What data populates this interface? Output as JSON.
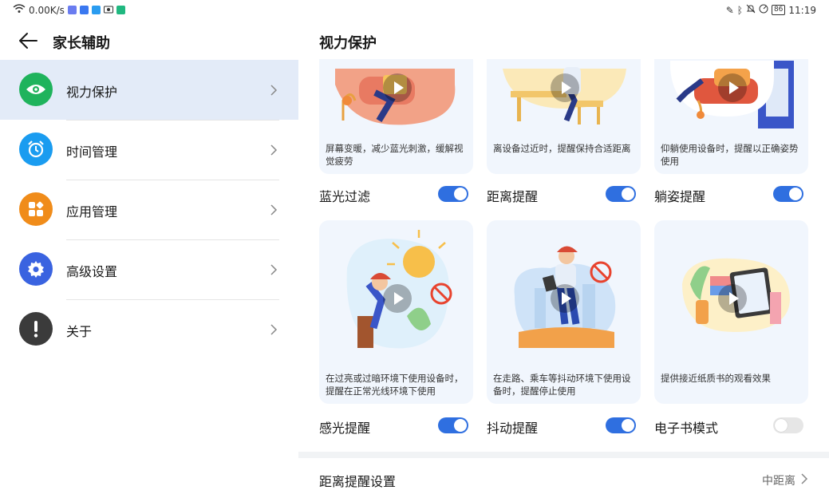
{
  "status_bar": {
    "net_speed": "0.00K/s",
    "battery": "86",
    "time": "11:19"
  },
  "header": {
    "title": "家长辅助"
  },
  "sidebar": {
    "items": [
      {
        "label": "视力保护",
        "icon": "eye-icon",
        "color": "#1fb35c"
      },
      {
        "label": "时间管理",
        "icon": "alarm-clock-icon",
        "color": "#1a9cf0"
      },
      {
        "label": "应用管理",
        "icon": "apps-icon",
        "color": "#f08c1a"
      },
      {
        "label": "高级设置",
        "icon": "gear-icon",
        "color": "#3a63e0"
      },
      {
        "label": "关于",
        "icon": "info-icon",
        "color": "#3b3b3b"
      }
    ]
  },
  "main": {
    "title": "视力保护",
    "cards": [
      {
        "desc": "屏幕变暖，减少蓝光刺激，缓解视觉疲劳",
        "label": "蓝光过滤",
        "enabled": true
      },
      {
        "desc": "离设备过近时，提醒保持合适距离",
        "label": "距离提醒",
        "enabled": true
      },
      {
        "desc": "仰躺使用设备时，提醒以正确姿势使用",
        "label": "躺姿提醒",
        "enabled": true
      },
      {
        "desc": "在过亮或过暗环境下使用设备时，提醒在正常光线环境下使用",
        "label": "感光提醒",
        "enabled": true
      },
      {
        "desc": "在走路、乘车等抖动环境下使用设备时，提醒停止使用",
        "label": "抖动提醒",
        "enabled": true
      },
      {
        "desc": "提供接近纸质书的观看效果",
        "label": "电子书模式",
        "enabled": false
      }
    ],
    "distance_setting": {
      "label": "距离提醒设置",
      "value": "中距离"
    }
  },
  "colors": {
    "accent": "#2f6fe0",
    "active_bg": "#e3ebf8"
  }
}
